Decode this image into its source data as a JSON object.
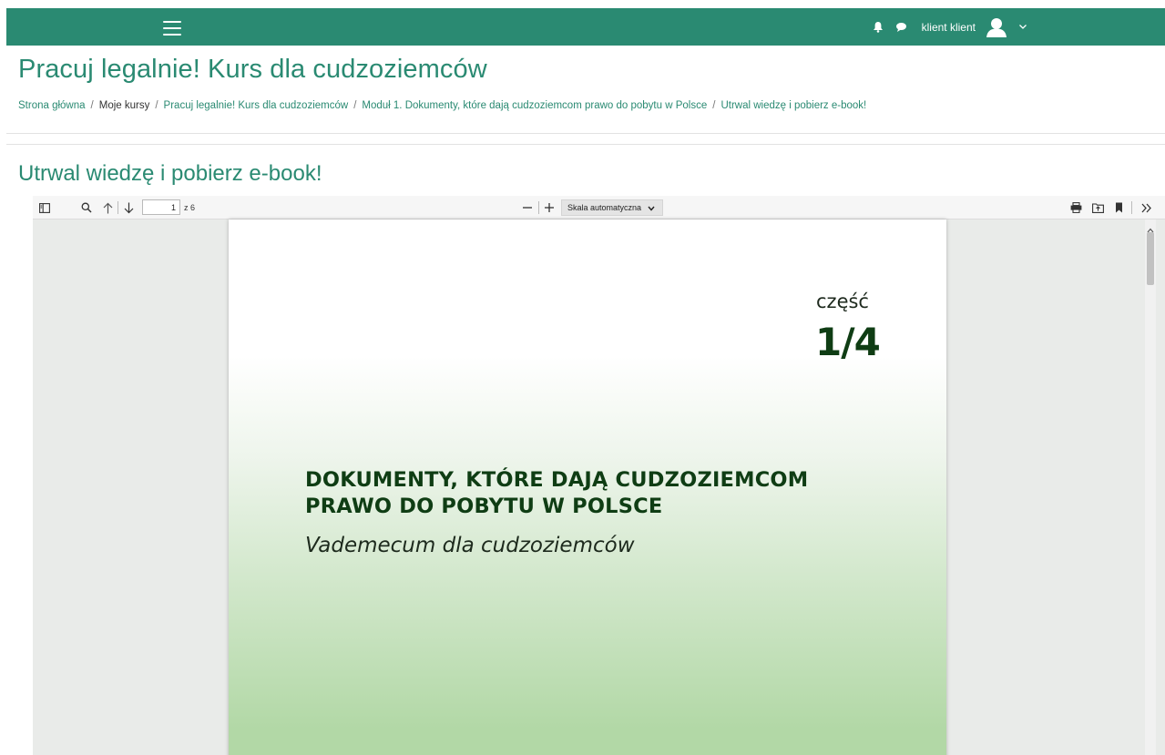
{
  "topbar": {
    "menu_icon": "hamburger-icon",
    "notification_icon": "bell-icon",
    "messages_icon": "chat-bubble-icon",
    "user_name": "klient klient",
    "avatar_icon": "user-avatar-icon",
    "user_menu_icon": "caret-down-icon",
    "bg_color": "#2a8a72"
  },
  "page": {
    "title": "Pracuj legalnie! Kurs dla cudzoziemców",
    "section_title": "Utrwal wiedzę i pobierz e-book!",
    "accent_color": "#2a8a72"
  },
  "breadcrumb": {
    "items": [
      "Strona główna",
      "Moje kursy",
      "Pracuj legalnie! Kurs dla cudzoziemców",
      "Moduł 1. Dokumenty, które dają cudzoziemcom prawo do pobytu w Polsce",
      "Utrwal wiedzę i pobierz e-book!"
    ],
    "separator": "/"
  },
  "pdf_toolbar": {
    "sidebar_toggle_icon": "sidebar-toggle-icon",
    "search_icon": "search-icon",
    "prev_page_icon": "arrow-up-icon",
    "next_page_icon": "arrow-down-icon",
    "page_number": "1",
    "page_count_label": "z 6",
    "zoom_out_icon": "minus-icon",
    "zoom_in_icon": "plus-icon",
    "scale_value": "Skala automatyczna",
    "print_icon": "print-icon",
    "open_file_icon": "open-file-icon",
    "bookmark_icon": "bookmark-icon",
    "tools_icon": "double-chevron-right-icon"
  },
  "pdf_page": {
    "part_label": "część",
    "part_number": "1/4",
    "title_line1": "DOKUMENTY, KTÓRE DAJĄ CUDZOZIEMCOM",
    "title_line2": "PRAWO DO POBYTU W POLSCE",
    "subtitle": "Vademecum dla cudzoziemców",
    "title_color": "#0f3d14"
  }
}
